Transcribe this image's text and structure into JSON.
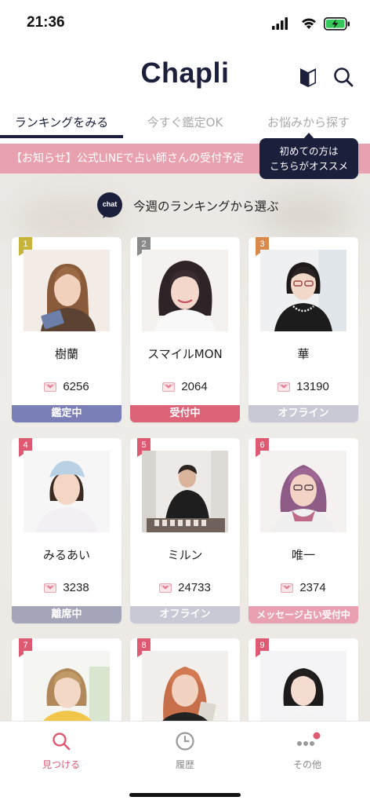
{
  "status_bar": {
    "time": "21:36"
  },
  "header": {
    "title": "Chapli"
  },
  "tabs": [
    {
      "label": "ランキングをみる",
      "active": true
    },
    {
      "label": "今すぐ鑑定OK",
      "active": false
    },
    {
      "label": "お悩みから探す",
      "active": false
    }
  ],
  "notice": {
    "text": "【お知らせ】公式LINEで占い師さんの受付予定"
  },
  "tooltip": {
    "line1": "初めての方は",
    "line2": "こちらがオススメ"
  },
  "ranking": {
    "chat_icon_text": "chat",
    "title": "今週のランキングから選ぶ"
  },
  "cards": [
    {
      "rank": "1",
      "name": "樹蘭",
      "count": "6256",
      "status": "鑑定中",
      "status_color": "#7a7fb8",
      "rank_color": "#c6b53a"
    },
    {
      "rank": "2",
      "name": "スマイルMON",
      "count": "2064",
      "status": "受付中",
      "status_color": "#dd6378",
      "rank_color": "#8a8a8a"
    },
    {
      "rank": "3",
      "name": "華",
      "count": "13190",
      "status": "オフライン",
      "status_color": "#c9c9d6",
      "rank_color": "#d9894a"
    },
    {
      "rank": "4",
      "name": "みるあい",
      "count": "3238",
      "status": "離席中",
      "status_color": "#a5a5ba",
      "rank_color": "#dd5a72"
    },
    {
      "rank": "5",
      "name": "ミルン",
      "count": "24733",
      "status": "オフライン",
      "status_color": "#c9c9d6",
      "rank_color": "#dd5a72"
    },
    {
      "rank": "6",
      "name": "唯一",
      "count": "2374",
      "status": "メッセージ占い受付中",
      "status_color": "#e9a0b0",
      "rank_color": "#dd5a72"
    },
    {
      "rank": "7",
      "name": "",
      "count": "",
      "status": "",
      "status_color": "#ffffff",
      "rank_color": "#dd5a72"
    },
    {
      "rank": "8",
      "name": "",
      "count": "",
      "status": "",
      "status_color": "#ffffff",
      "rank_color": "#dd5a72"
    },
    {
      "rank": "9",
      "name": "",
      "count": "",
      "status": "",
      "status_color": "#ffffff",
      "rank_color": "#dd5a72"
    }
  ],
  "bottom_nav": [
    {
      "label": "見つける",
      "icon": "search-icon",
      "active": true
    },
    {
      "label": "履歴",
      "icon": "clock-icon",
      "active": false
    },
    {
      "label": "その他",
      "icon": "more-icon",
      "active": false
    }
  ],
  "colors": {
    "brand_navy": "#1b1f3b",
    "accent_pink": "#dd5a72",
    "notice_pink": "#e8a1ae"
  }
}
